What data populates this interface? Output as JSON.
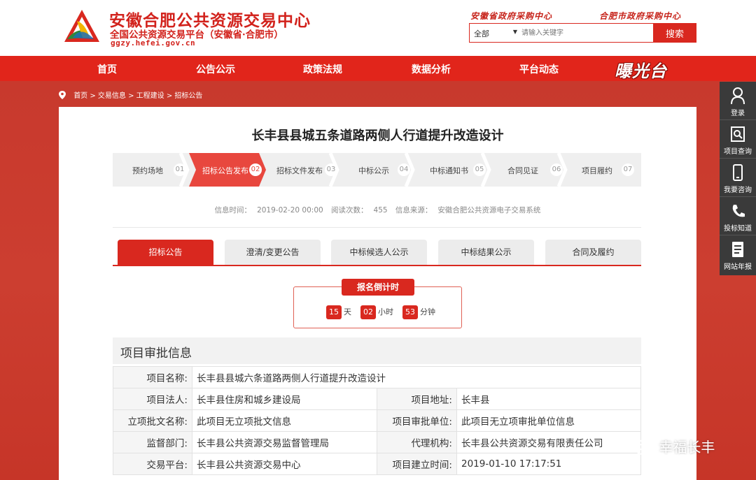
{
  "header": {
    "title": "安徽合肥公共资源交易中心",
    "subtitle": "全国公共资源交易平台（安徽省·合肥市）",
    "url": "ggzy.hefei.gov.cn",
    "top_links": [
      "安徽省政府采购中心",
      "合肥市政府采购中心"
    ],
    "search": {
      "select_value": "全部",
      "placeholder": "请输入关键字",
      "button": "搜索"
    }
  },
  "nav": {
    "items": [
      "首页",
      "公告公示",
      "政策法规",
      "数据分析",
      "平台动态"
    ],
    "logo_text": "曝光台"
  },
  "breadcrumb": "首页 > 交易信息 > 工程建设 > 招标公告",
  "page_title": "长丰县县城五条道路两侧人行道提升改造设计",
  "steps": [
    {
      "label": "预约场地",
      "num": "01"
    },
    {
      "label": "招标公告发布",
      "num": "02"
    },
    {
      "label": "招标文件发布",
      "num": "03"
    },
    {
      "label": "中标公示",
      "num": "04"
    },
    {
      "label": "中标通知书",
      "num": "05"
    },
    {
      "label": "合同见证",
      "num": "06"
    },
    {
      "label": "项目履约",
      "num": "07"
    }
  ],
  "meta": {
    "time_label": "信息时间：",
    "time_value": "2019-02-20 00:00",
    "views_label": "阅读次数：",
    "views_value": "455",
    "source_label": "信息来源：",
    "source_value": "安徽合肥公共资源电子交易系统"
  },
  "tabs": [
    "招标公告",
    "澄清/变更公告",
    "中标候选人公示",
    "中标结果公示",
    "合同及履约"
  ],
  "countdown": {
    "title": "报名倒计时",
    "days": "15",
    "days_unit": "天",
    "hours": "02",
    "hours_unit": "小时",
    "minutes": "53",
    "minutes_unit": "分钟"
  },
  "section_title": "项目审批信息",
  "info": {
    "name_label": "项目名称:",
    "name_value": "长丰县县城六条道路两侧人行道提升改造设计",
    "legal_label": "项目法人:",
    "legal_value": "长丰县住房和城乡建设局",
    "addr_label": "项目地址:",
    "addr_value": "长丰县",
    "doc_label": "立项批文名称:",
    "doc_value": "此项目无立项批文信息",
    "unit_label": "项目审批单位:",
    "unit_value": "此项目无立项审批单位信息",
    "dept_label": "监督部门:",
    "dept_value": "长丰县公共资源交易监督管理局",
    "agent_label": "代理机构:",
    "agent_value": "长丰县公共资源交易有限责任公司",
    "platform_label": "交易平台:",
    "platform_value": "长丰县公共资源交易中心",
    "built_label": "项目建立时间:",
    "built_value": "2019-01-10 17:17:51"
  },
  "float_bar": [
    "登录",
    "项目查询",
    "我要咨询",
    "投标知道",
    "网站年报"
  ],
  "watermark": "幸福长丰"
}
